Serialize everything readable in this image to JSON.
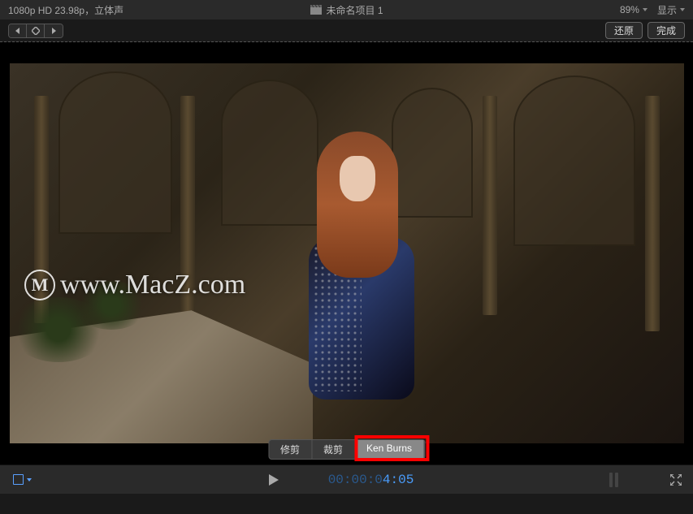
{
  "header": {
    "format_info": "1080p HD 23.98p，立体声",
    "project_title": "未命名项目 1",
    "zoom_level": "89%",
    "display_label": "显示"
  },
  "toolbar": {
    "restore_label": "还原",
    "done_label": "完成"
  },
  "watermark": {
    "logo_letter": "M",
    "text": "www.MacZ.com"
  },
  "crop_tabs": {
    "trim": "修剪",
    "crop": "裁剪",
    "ken_burns": "Ken Burns"
  },
  "footer": {
    "timecode_dim": "00:00:0",
    "timecode_bright": "4:05"
  }
}
